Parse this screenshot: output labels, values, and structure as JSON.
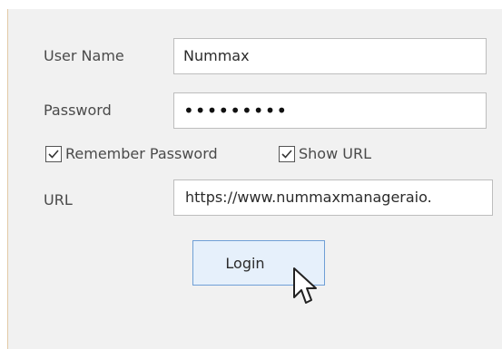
{
  "form": {
    "username_label": "User Name",
    "username_value": "Nummax",
    "password_label": "Password",
    "password_value": "•••••••••",
    "remember_password_label": "Remember Password",
    "remember_password_checked": true,
    "show_url_label": "Show URL",
    "show_url_checked": true,
    "url_label": "URL",
    "url_value": "https://www.nummaxmanageraio.",
    "login_label": "Login"
  },
  "icons": {
    "checkbox": "checkmark-icon",
    "cursor": "mouse-pointer-icon"
  }
}
